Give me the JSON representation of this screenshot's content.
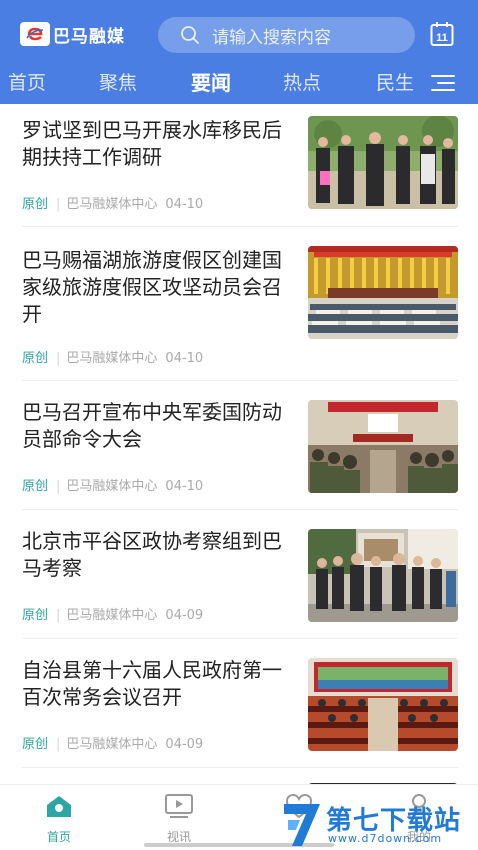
{
  "header": {
    "app_name": "巴马融媒",
    "search_placeholder": "请输入搜索内容",
    "calendar_day": "11"
  },
  "tabs": [
    {
      "label": "首页",
      "active": false
    },
    {
      "label": "聚焦",
      "active": false
    },
    {
      "label": "要闻",
      "active": true
    },
    {
      "label": "热点",
      "active": false
    },
    {
      "label": "民生",
      "active": false
    }
  ],
  "articles": [
    {
      "title": "罗试坚到巴马开展水库移民后期扶持工作调研",
      "tag": "原创",
      "source": "巴马融媒体中心",
      "date": "04-10",
      "thumbnail": "officials-outdoor-photo"
    },
    {
      "title": "巴马赐福湖旅游度假区创建国家级旅游度假区攻坚动员会召开",
      "tag": "原创",
      "source": "巴马融媒体中心",
      "date": "04-10",
      "thumbnail": "conference-hall-photo"
    },
    {
      "title": "巴马召开宣布中央军委国防动员部命令大会",
      "tag": "原创",
      "source": "巴马融媒体中心",
      "date": "04-10",
      "thumbnail": "meeting-room-photo"
    },
    {
      "title": "北京市平谷区政协考察组到巴马考察",
      "tag": "原创",
      "source": "巴马融媒体中心",
      "date": "04-09",
      "thumbnail": "delegation-visit-photo"
    },
    {
      "title": "自治县第十六届人民政府第一百次常务会议召开",
      "tag": "原创",
      "source": "巴马融媒体中心",
      "date": "04-09",
      "thumbnail": "government-meeting-photo"
    }
  ],
  "bottom_nav": [
    {
      "label": "首页",
      "icon": "home-icon",
      "active": true
    },
    {
      "label": "视讯",
      "icon": "video-icon",
      "active": false
    },
    {
      "label": "",
      "icon": "service-icon",
      "active": false
    },
    {
      "label": "我的",
      "icon": "profile-icon",
      "active": false
    }
  ],
  "watermark": {
    "text": "第七下载站",
    "url": "www.d7down.com"
  },
  "colors": {
    "header_blue": "#4a7ee3",
    "accent_teal": "#2ca6a3",
    "watermark_blue": "#1f7bd6"
  }
}
